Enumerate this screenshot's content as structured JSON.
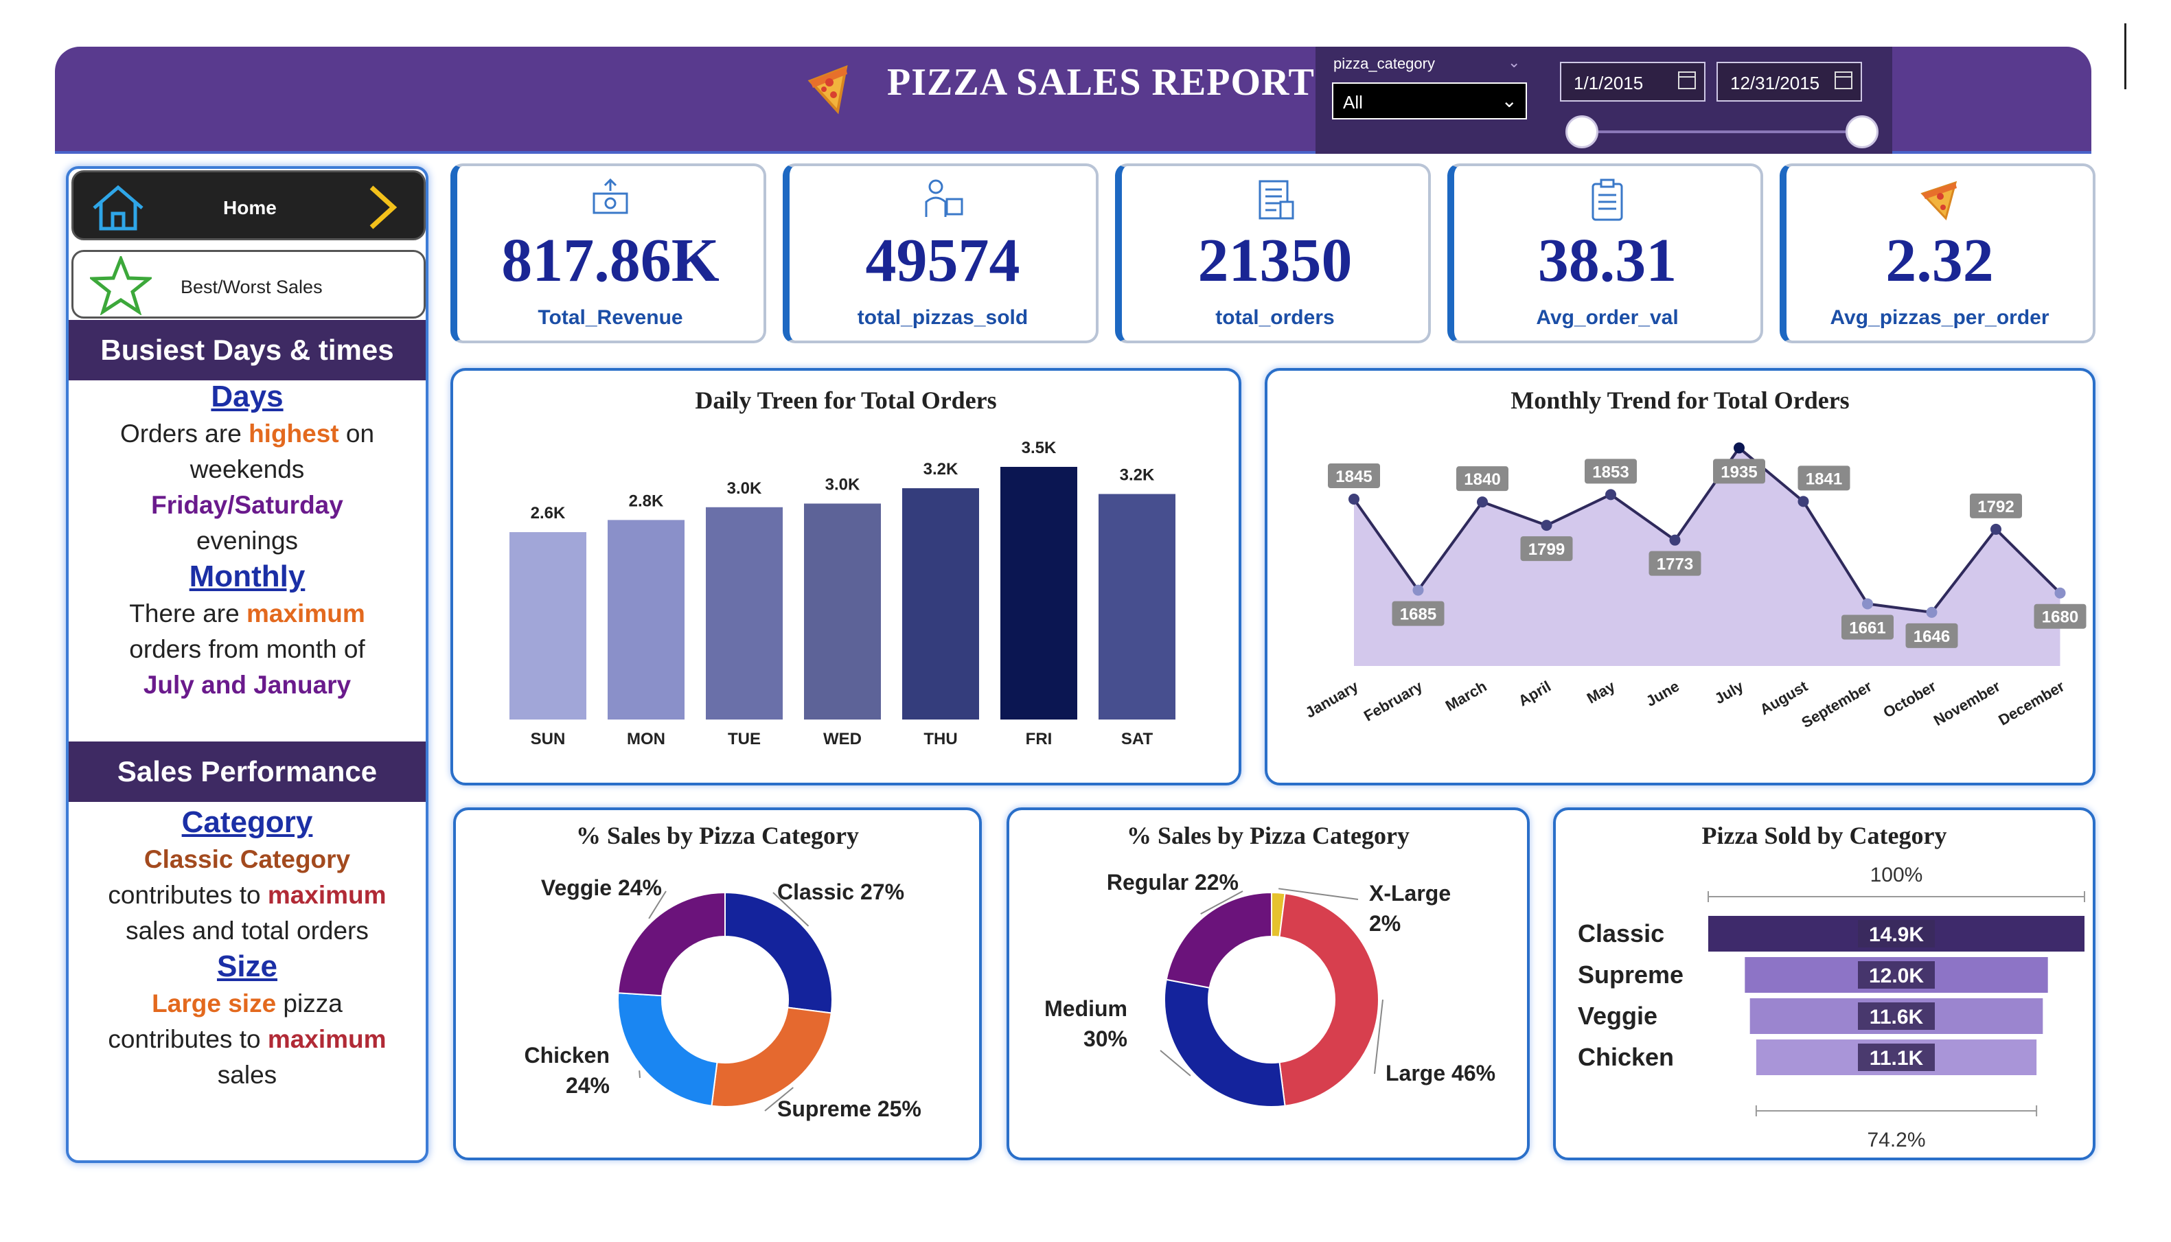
{
  "header": {
    "title": "PIZZA SALES REPORT",
    "slicer_label": "pizza_category",
    "slicer_value": "All",
    "date_start": "1/1/2015",
    "date_end": "12/31/2015"
  },
  "nav": {
    "home": "Home",
    "best_worst": "Best/Worst Sales"
  },
  "busiest": {
    "title": "Busiest Days & times",
    "days_head": "Days",
    "days_l1a": "Orders are ",
    "days_l1b": "highest",
    "days_l1c": " on",
    "days_l2": "weekends",
    "days_l3": "Friday/Saturday",
    "days_l4": "evenings",
    "monthly_head": "Monthly",
    "monthly_l1a": "There are ",
    "monthly_l1b": "maximum",
    "monthly_l2": "orders from month of",
    "monthly_l3": "July and January"
  },
  "sales_perf": {
    "title": "Sales Performance",
    "cat_head": "Category",
    "cat_l1": "Classic Category",
    "cat_l2a": "contributes to ",
    "cat_l2b": "maximum",
    "cat_l3": "sales and total orders",
    "size_head": "Size",
    "size_l1a": "Large size",
    "size_l1b": " pizza",
    "size_l2a": "contributes to ",
    "size_l2b": "maximum",
    "size_l3": "sales"
  },
  "kpis": [
    {
      "value": "817.86K",
      "label": "Total_Revenue",
      "icon": "money-icon"
    },
    {
      "value": "49574",
      "label": "total_pizzas_sold",
      "icon": "delivery-icon"
    },
    {
      "value": "21350",
      "label": "total_orders",
      "icon": "order-list-icon"
    },
    {
      "value": "38.31",
      "label": "Avg_order_val",
      "icon": "clipboard-icon"
    },
    {
      "value": "2.32",
      "label": "Avg_pizzas_per_order",
      "icon": "pizza-icon"
    }
  ],
  "colors": {
    "header": "#593a8e",
    "accent_blue": "#1a2694",
    "card_border": "#2a6fc9"
  },
  "chart_data": [
    {
      "type": "bar",
      "title": "Daily Treen for Total Orders",
      "categories": [
        "SUN",
        "MON",
        "TUE",
        "WED",
        "THU",
        "FRI",
        "SAT"
      ],
      "values": [
        2624,
        2794,
        2973,
        3024,
        3239,
        3538,
        3158
      ],
      "labels": [
        "2.6K",
        "2.8K",
        "3.0K",
        "3.0K",
        "3.2K",
        "3.5K",
        "3.2K"
      ],
      "colors": [
        "#a1a6d8",
        "#8a90c9",
        "#6a70a9",
        "#5d6398",
        "#343d7c",
        "#0b1652",
        "#474f8f"
      ],
      "ylim": [
        0,
        3538
      ]
    },
    {
      "type": "area",
      "title": "Monthly Trend for Total Orders",
      "categories": [
        "January",
        "February",
        "March",
        "April",
        "May",
        "June",
        "July",
        "August",
        "September",
        "October",
        "November",
        "December"
      ],
      "values": [
        1845,
        1685,
        1840,
        1799,
        1853,
        1773,
        1935,
        1841,
        1661,
        1646,
        1792,
        1680
      ],
      "ylim": [
        1600,
        1950
      ]
    },
    {
      "type": "pie",
      "title": "% Sales by Pizza Category",
      "labels": [
        "Classic 27%",
        "Supreme 25%",
        "Chicken",
        "Veggie 24%"
      ],
      "second_line": [
        "",
        "",
        "24%",
        ""
      ],
      "values": [
        27,
        25,
        24,
        24
      ],
      "colors": [
        "#14239c",
        "#e5692f",
        "#1a86f2",
        "#6b137b"
      ]
    },
    {
      "type": "pie",
      "title": "% Sales by Pizza Category",
      "labels": [
        "X-Large",
        "Large 46%",
        "Medium",
        "Regular 22%"
      ],
      "second_line": [
        "2%",
        "",
        "30%",
        ""
      ],
      "values": [
        2,
        46,
        30,
        22
      ],
      "colors": [
        "#e6c22e",
        "#d73f4e",
        "#14239c",
        "#6b137b"
      ]
    },
    {
      "type": "bar",
      "title": "Pizza Sold by Category",
      "categories": [
        "Classic",
        "Supreme",
        "Veggie",
        "Chicken"
      ],
      "values": [
        14.9,
        12.0,
        11.6,
        11.1
      ],
      "labels": [
        "14.9K",
        "12.0K",
        "11.6K",
        "11.1K"
      ],
      "top_label": "100%",
      "bottom_label": "74.2%",
      "colors": [
        "#3e2a6b",
        "#8d74c6",
        "#9b85cf",
        "#a995d8"
      ]
    }
  ]
}
